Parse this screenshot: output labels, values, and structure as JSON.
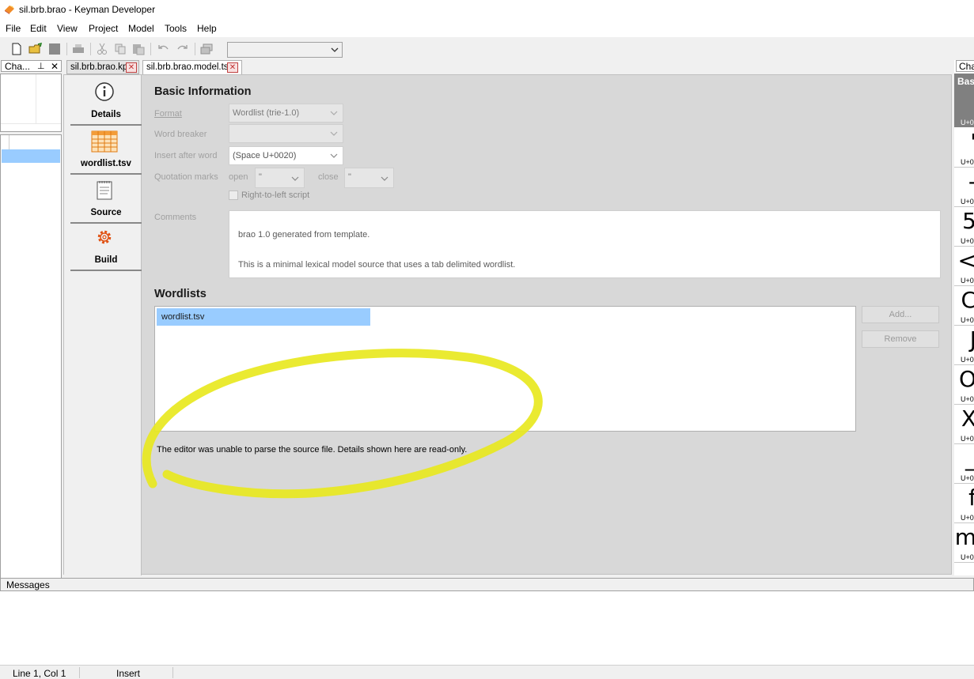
{
  "window": {
    "title": "sil.brb.brao - Keyman Developer"
  },
  "menu": {
    "items": [
      "File",
      "Edit",
      "View",
      "Project",
      "Model",
      "Tools",
      "Help"
    ]
  },
  "toolbar": {
    "combo_value": ""
  },
  "left_panel": {
    "title": "Cha..."
  },
  "tabs": [
    {
      "label": "sil.brb.brao.kpj"
    },
    {
      "label": "sil.brb.brao.model.ts"
    }
  ],
  "nav": {
    "details": "Details",
    "wordlist": "wordlist.tsv",
    "source": "Source",
    "build": "Build"
  },
  "basic": {
    "heading": "Basic Information",
    "format_label": "Format",
    "format_value": "Wordlist (trie-1.0)",
    "word_breaker_label": "Word breaker",
    "word_breaker_value": "",
    "insert_after_label": "Insert after word",
    "insert_after_value": "(Space U+0020)",
    "quotation_label": "Quotation marks",
    "open_label": "open",
    "open_value": "\"",
    "close_label": "close",
    "close_value": "\"",
    "rtl_label": "Right-to-left script",
    "rtl_checked": false,
    "comments_label": "Comments",
    "comments_line1": "brao 1.0 generated from template.",
    "comments_line2": "This is a minimal lexical model source that uses a tab delimited wordlist."
  },
  "wordlists": {
    "heading": "Wordlists",
    "items": [
      "wordlist.tsv"
    ],
    "add_label": "Add...",
    "remove_label": "Remove",
    "readonly_message": "The editor was unable to parse the source file. Details shown here are read-only."
  },
  "right_panel": {
    "title": "Cha",
    "selected_label": "Bas",
    "chars": [
      {
        "glyph": "'",
        "code": "U+0"
      },
      {
        "glyph": "-",
        "code": "U+0"
      },
      {
        "glyph": "5",
        "code": "U+0"
      },
      {
        "glyph": "<",
        "code": "U+0"
      },
      {
        "glyph": "C",
        "code": "U+0"
      },
      {
        "glyph": "J",
        "code": "U+0"
      },
      {
        "glyph": "O",
        "code": "U+0"
      },
      {
        "glyph": "X",
        "code": "U+0"
      },
      {
        "glyph": "_",
        "code": "U+0"
      },
      {
        "glyph": "f",
        "code": "U+0"
      },
      {
        "glyph": "m",
        "code": "U+0"
      }
    ],
    "first_code": "U+0"
  },
  "messages": {
    "title": "Messages"
  },
  "status": {
    "position": "Line 1, Col 1",
    "mode": "Insert"
  },
  "colors": {
    "selection": "#99ccff",
    "highlight_annotation": "#f0f000"
  }
}
